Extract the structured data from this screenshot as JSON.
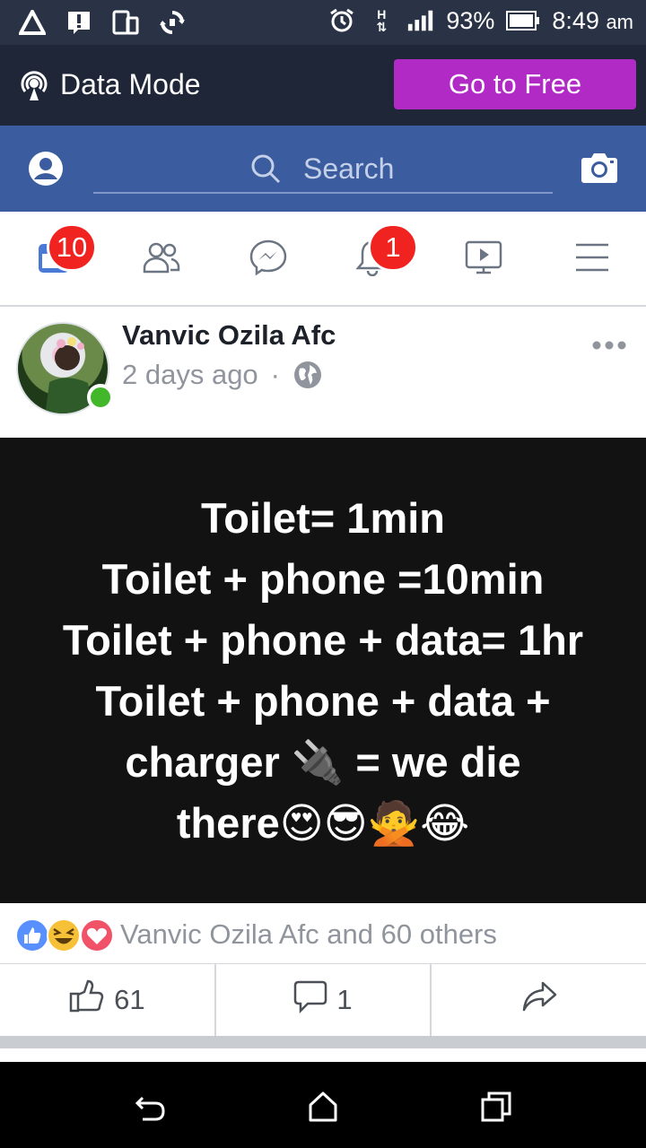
{
  "status_bar": {
    "battery": "93%",
    "time": "8:49",
    "ampm": "am",
    "network_type": "H"
  },
  "data_mode": {
    "label": "Data Mode",
    "go_free_label": "Go to Free"
  },
  "header": {
    "search_placeholder": "Search"
  },
  "nav": {
    "news_feed_badge": "10",
    "notifications_badge": "1"
  },
  "post": {
    "author": "Vanvic Ozila Afc",
    "time": "2 days ago",
    "separator": "·",
    "text": "Toilet= 1min\nToilet + phone =10min\nToilet + phone + data= 1hr\nToilet + phone + data +\ncharger 🔌 = we die\nthere😍😎🙅😂",
    "reactions_summary": "Vanvic Ozila Afc and 60 others",
    "like_count": "61",
    "comment_count": "1"
  },
  "colors": {
    "status_bar_bg": "#2a3346",
    "fb_blue": "#3b5c9e",
    "go_free_purple": "#b12ac6",
    "badge_red": "#f02320",
    "online_green": "#42b72a",
    "post_bg": "#121212"
  }
}
